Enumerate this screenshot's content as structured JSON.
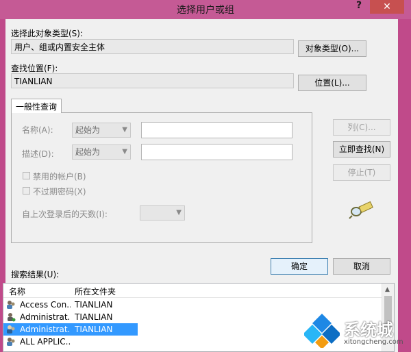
{
  "window": {
    "title": "选择用户或组",
    "help": "?",
    "close": "✕"
  },
  "object_type": {
    "label": "选择此对象类型(S):",
    "value": "用户、组或内置安全主体",
    "button": "对象类型(O)..."
  },
  "location": {
    "label": "查找位置(F):",
    "value": "TIANLIAN",
    "button": "位置(L)..."
  },
  "tab": {
    "label": "一般性查询"
  },
  "query": {
    "name_label": "名称(A):",
    "name_mode": "起始为",
    "desc_label": "描述(D):",
    "desc_mode": "起始为",
    "disabled_accounts": "禁用的帐户(B)",
    "non_expiring_pw": "不过期密码(X)",
    "days_label": "自上次登录后的天数(I):"
  },
  "buttons": {
    "columns": "列(C)...",
    "find_now": "立即查找(N)",
    "stop": "停止(T)",
    "ok": "确定",
    "cancel": "取消"
  },
  "results": {
    "label": "搜索结果(U):",
    "columns": [
      "名称",
      "所在文件夹"
    ],
    "rows": [
      {
        "name": "Access Con...",
        "folder": "TIANLIAN",
        "selected": false
      },
      {
        "name": "Administrat...",
        "folder": "TIANLIAN",
        "selected": false
      },
      {
        "name": "Administrat...",
        "folder": "TIANLIAN",
        "selected": true
      },
      {
        "name": "ALL APPLIC...",
        "folder": "",
        "selected": false
      }
    ]
  },
  "watermark": {
    "brand": "系统城",
    "url": "xitongcheng.com"
  },
  "colors": {
    "titlebar": "#c55a95",
    "selection": "#3399ff",
    "close": "#c75050"
  }
}
